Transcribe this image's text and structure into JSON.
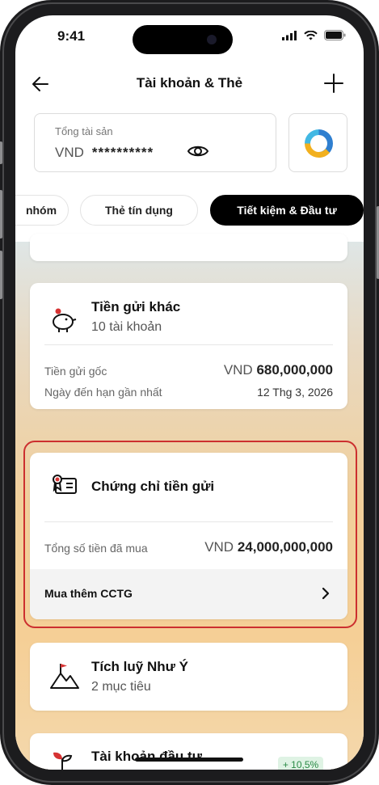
{
  "status_bar": {
    "time": "9:41"
  },
  "header": {
    "title": "Tài khoản & Thẻ"
  },
  "assets": {
    "label": "Tổng tài sản",
    "currency": "VND",
    "masked_value": "**********"
  },
  "tabs": [
    {
      "label": "nhóm"
    },
    {
      "label": "Thẻ tín dụng"
    },
    {
      "label": "Tiết kiệm & Đầu tư"
    }
  ],
  "cards": {
    "other_deposit": {
      "title": "Tiền gửi khác",
      "subtitle": "10 tài khoản",
      "principal_label": "Tiền gửi gốc",
      "principal_currency": "VND",
      "principal_amount": "680,000,000",
      "due_label": "Ngày đến hạn gần nhất",
      "due_date": "12 Thg 3, 2026"
    },
    "certificate": {
      "title": "Chứng chỉ tiền gửi",
      "total_label": "Tổng số tiền đã mua",
      "total_currency": "VND",
      "total_amount": "24,000,000,000",
      "buy_more_label": "Mua thêm CCTG"
    },
    "savings_goal": {
      "title": "Tích luỹ Như Ý",
      "subtitle": "2 mục tiêu"
    },
    "investment": {
      "title": "Tài khoản đầu tư",
      "badge": "+ 10,5%"
    }
  },
  "colors": {
    "accent": "#000000",
    "highlight": "#cc2f2f",
    "badge_text": "#2a8a46"
  }
}
